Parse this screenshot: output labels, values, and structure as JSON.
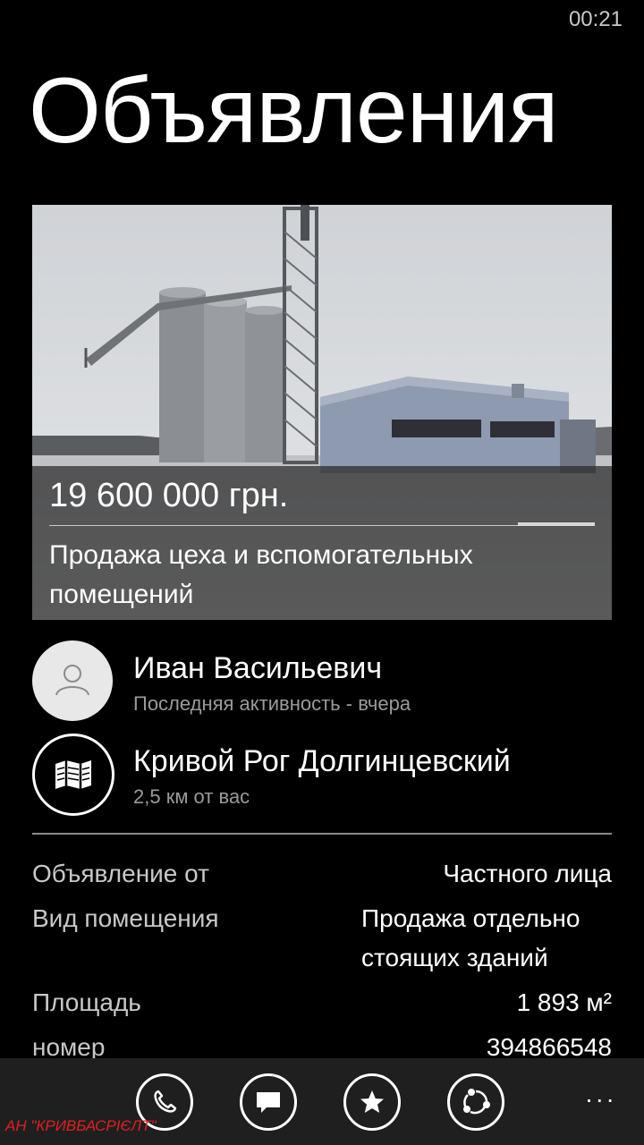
{
  "status_bar": {
    "time": "00:21"
  },
  "page": {
    "title": "Объявления"
  },
  "listing": {
    "price": "19 600 000 грн.",
    "title": "Продажа цеха и вспомогательных помещений",
    "image_icon": "industrial-building-photo"
  },
  "seller": {
    "name": "Иван Васильевич",
    "activity": "Последняя активность - вчера",
    "icon": "person-icon"
  },
  "location": {
    "name": "Кривой Рог Долгинцевский",
    "distance": "2,5 км от вас",
    "icon": "map-icon"
  },
  "details": [
    {
      "label": "Объявление от",
      "value": "Частного лица"
    },
    {
      "label": "Вид помещения",
      "value": "Продажа отдельно стоящих зданий"
    },
    {
      "label": "Площадь",
      "value": "1 893 м²"
    },
    {
      "label": "номер",
      "value": "394866548"
    }
  ],
  "app_bar": {
    "buttons": [
      {
        "name": "call",
        "icon": "phone-icon"
      },
      {
        "name": "message",
        "icon": "message-icon"
      },
      {
        "name": "favorite",
        "icon": "star-icon"
      },
      {
        "name": "share",
        "icon": "share-icon"
      }
    ],
    "more": "..."
  },
  "watermark": "АН \"КРИВБАСРІЄЛТ\""
}
